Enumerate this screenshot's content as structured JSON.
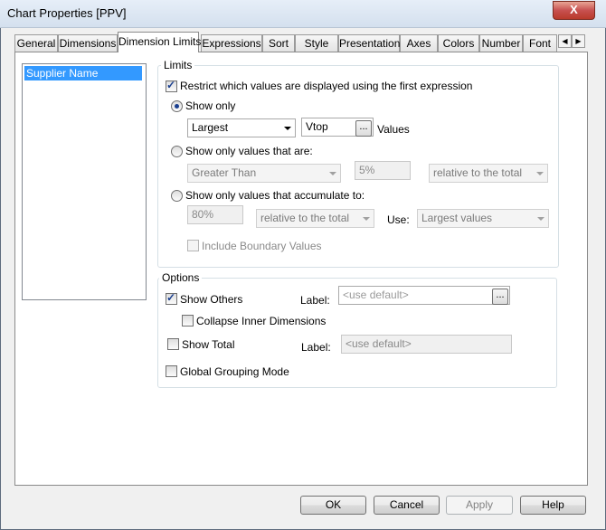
{
  "window": {
    "title": "Chart Properties [PPV]",
    "close_label": "X"
  },
  "tabs": [
    {
      "label": "General"
    },
    {
      "label": "Dimensions"
    },
    {
      "label": "Dimension Limits"
    },
    {
      "label": "Expressions"
    },
    {
      "label": "Sort"
    },
    {
      "label": "Style"
    },
    {
      "label": "Presentation"
    },
    {
      "label": "Axes"
    },
    {
      "label": "Colors"
    },
    {
      "label": "Number"
    },
    {
      "label": "Font"
    }
  ],
  "dimensions_list": {
    "items": [
      "Supplier Name"
    ]
  },
  "limits": {
    "group_label": "Limits",
    "restrict_label": "Restrict which values are displayed using the first expression",
    "show_only_label": "Show only",
    "show_only_combo": "Largest",
    "show_only_value": "Vtop",
    "values_label": "Values",
    "dots": "...",
    "values_are_label": "Show only values that are:",
    "values_are_combo": "Greater Than",
    "values_are_percent": "5%",
    "values_are_relative": "relative to the total",
    "accumulate_label": "Show only values that accumulate to:",
    "accumulate_percent": "80%",
    "accumulate_relative": "relative to the total",
    "use_label": "Use:",
    "use_combo": "Largest values",
    "include_boundary_label": "Include Boundary Values"
  },
  "options": {
    "group_label": "Options",
    "show_others_label": "Show Others",
    "others_label_label": "Label:",
    "others_label_placeholder": "<use default>",
    "collapse_label": "Collapse Inner Dimensions",
    "show_total_label": "Show Total",
    "total_label_label": "Label:",
    "total_label_placeholder": "<use default>",
    "global_grouping_label": "Global Grouping Mode"
  },
  "buttons": {
    "ok": "OK",
    "cancel": "Cancel",
    "apply": "Apply",
    "help": "Help"
  }
}
